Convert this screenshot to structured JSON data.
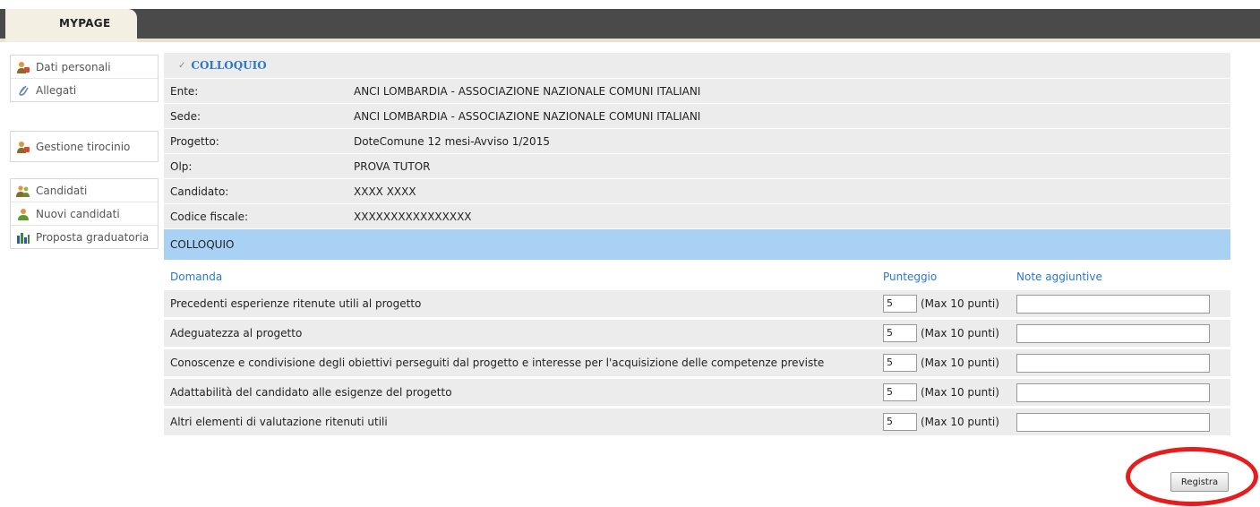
{
  "nav": {
    "tab_label": "MYPAGE"
  },
  "sidebar": {
    "group1": [
      {
        "label": "Dati personali",
        "icon": "user-edit-icon"
      },
      {
        "label": "Allegati",
        "icon": "paperclip-icon"
      }
    ],
    "group2": [
      {
        "label": "Gestione tirocinio",
        "icon": "user-edit-icon"
      }
    ],
    "group3": [
      {
        "label": "Candidati",
        "icon": "users-icon"
      },
      {
        "label": "Nuovi candidati",
        "icon": "user-icon"
      },
      {
        "label": "Proposta graduatoria",
        "icon": "bar-chart-icon"
      }
    ]
  },
  "panel": {
    "title": "COLLOQUIO",
    "info": [
      {
        "label": "Ente:",
        "value": "ANCI LOMBARDIA - ASSOCIAZIONE NAZIONALE COMUNI ITALIANI"
      },
      {
        "label": "Sede:",
        "value": "ANCI LOMBARDIA - ASSOCIAZIONE NAZIONALE COMUNI ITALIANI"
      },
      {
        "label": "Progetto:",
        "value": "DoteComune 12 mesi-Avviso 1/2015"
      },
      {
        "label": "Olp:",
        "value": "PROVA TUTOR"
      },
      {
        "label": "Candidato:",
        "value": "XXXX XXXX"
      },
      {
        "label": "Codice fiscale:",
        "value": "XXXXXXXXXXXXXXXX"
      }
    ],
    "section_title": "COLLOQUIO",
    "columns": {
      "question": "Domanda",
      "score": "Punteggio",
      "notes": "Note aggiuntive"
    },
    "questions": [
      {
        "text": "Precedenti esperienze ritenute utili al progetto",
        "score": "5",
        "max": "(Max 10 punti)",
        "note": ""
      },
      {
        "text": "Adeguatezza al progetto",
        "score": "5",
        "max": "(Max 10 punti)",
        "note": ""
      },
      {
        "text": "Conoscenze e condivisione degli obiettivi perseguiti dal progetto e interesse per l'acquisizione delle competenze previste",
        "score": "5",
        "max": "(Max 10 punti)",
        "note": ""
      },
      {
        "text": "Adattabilità del candidato alle esigenze del progetto",
        "score": "5",
        "max": "(Max 10 punti)",
        "note": ""
      },
      {
        "text": "Altri elementi di valutazione ritenuti utili",
        "score": "5",
        "max": "(Max 10 punti)",
        "note": ""
      }
    ],
    "submit_label": "Registra"
  },
  "colors": {
    "accent": "#2a78c8",
    "section_bar": "#a8d1f4",
    "row_bg": "#ececec",
    "highlight": "#e51d1d",
    "topbar": "#4a4a4a"
  }
}
